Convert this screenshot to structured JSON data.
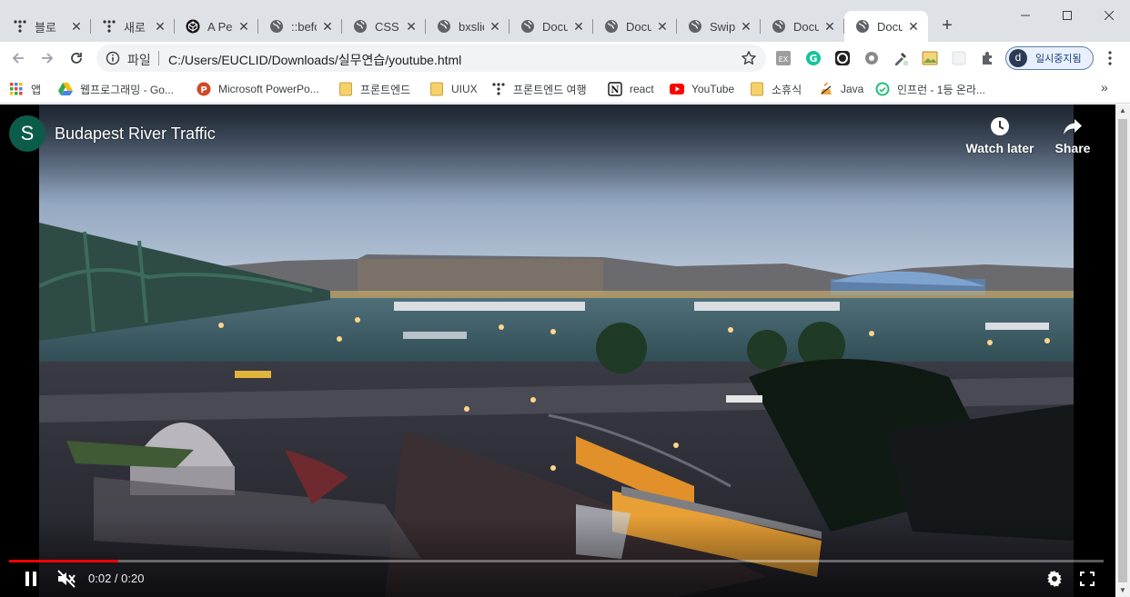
{
  "browser": {
    "tabs": [
      {
        "title": "블로",
        "icon": "tistory-dots-icon"
      },
      {
        "title": "새로",
        "icon": "tistory-dots-icon"
      },
      {
        "title": "A Pe",
        "icon": "codepen-icon"
      },
      {
        "title": "::befo",
        "icon": "globe-icon"
      },
      {
        "title": "CSS",
        "icon": "globe-icon"
      },
      {
        "title": "bxslid",
        "icon": "globe-icon"
      },
      {
        "title": "Docu",
        "icon": "globe-icon"
      },
      {
        "title": "Docu",
        "icon": "globe-icon"
      },
      {
        "title": "Swipe",
        "icon": "globe-icon"
      },
      {
        "title": "Docu",
        "icon": "globe-icon"
      },
      {
        "title": "Docu",
        "icon": "globe-icon",
        "active": true
      }
    ],
    "address": {
      "scheme_label": "파일",
      "url": "C:/Users/EUCLID/Downloads/실무연습/youtube.html"
    },
    "profile": {
      "initial": "d",
      "label": "일시중지됨"
    }
  },
  "bookmarks": [
    {
      "label": "앱",
      "icon": "apps-grid-icon"
    },
    {
      "label": "웹프로그래밍 - Go...",
      "icon": "google-drive-icon"
    },
    {
      "label": "Microsoft PowerPo...",
      "icon": "powerpoint-icon"
    },
    {
      "label": "프론트엔드",
      "icon": "folder-icon"
    },
    {
      "label": "UIUX",
      "icon": "folder-icon"
    },
    {
      "label": "프론트엔드 여행",
      "icon": "tistory-dots-icon"
    },
    {
      "label": "react",
      "icon": "notion-icon"
    },
    {
      "label": "YouTube",
      "icon": "youtube-icon"
    },
    {
      "label": "소휴식",
      "icon": "folder-icon"
    },
    {
      "label": "Java",
      "icon": "java-icon"
    },
    {
      "label": "인프런 - 1등 온라...",
      "icon": "inflearn-icon"
    }
  ],
  "video": {
    "channel_initial": "S",
    "title": "Budapest River Traffic",
    "watch_later_label": "Watch later",
    "share_label": "Share",
    "time_display": "0:02 / 0:20",
    "progress_fraction": 0.1
  },
  "colors": {
    "progress": "#ff0000",
    "channel_avatar": "#0b5d4a",
    "tabstrip": "#dee1e6"
  }
}
